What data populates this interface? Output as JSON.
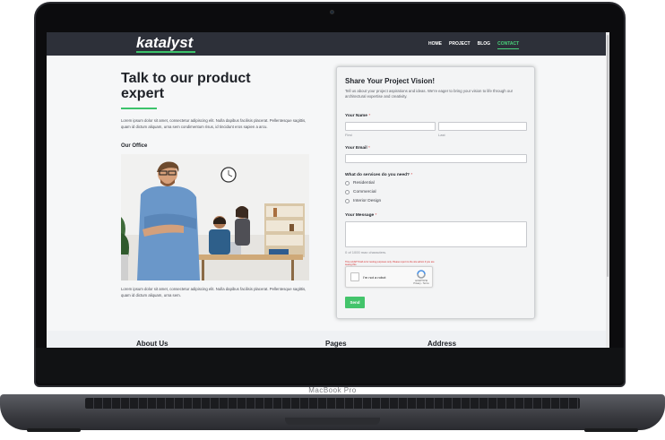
{
  "device": {
    "label": "MacBook Pro"
  },
  "nav": {
    "logo": "katalyst",
    "items": [
      {
        "label": "HOME",
        "active": false
      },
      {
        "label": "PROJECT",
        "active": false
      },
      {
        "label": "BLOG",
        "active": false
      },
      {
        "label": "CONTACT",
        "active": true
      }
    ]
  },
  "hero": {
    "title": "Talk to our product expert",
    "intro": "Lorem ipsum dolor sit amet, consectetur adipiscing elit. Nulla dapibus facilisis placerat. Pellentesque sagittis, quam id dictum aliquam, urna sem condimentum risus, id tincidunt eros sapien a arcu.",
    "office_heading": "Our Office",
    "outro": "Lorem ipsum dolor sit amet, consectetur adipiscing elit. Nulla dapibus facilisis placerat. Pellentesque sagittis, quam id dictum aliquam, urna sem."
  },
  "form": {
    "title": "Share Your Project Vision!",
    "subtitle": "Tell us about your project aspirations and ideas. We're eager to bring your vision to life through our architectural expertise and creativity.",
    "name_label": "Your Name",
    "required_mark": "*",
    "first_hint": "First",
    "last_hint": "Last",
    "email_label": "Your Email",
    "services_label": "What do services do you need?",
    "services": [
      "Residential",
      "Commercial",
      "Interior Design"
    ],
    "message_label": "Your Message",
    "char_count": "0 of 1000 max characters.",
    "captcha_warning": "This reCAPTCHA is for testing purposes only. Please report to the site admin if you are seeing this.",
    "captcha_label": "I'm not a robot",
    "captcha_brand": "reCAPTCHA",
    "captcha_links": "Privacy - Terms",
    "send_label": "Send"
  },
  "footer": {
    "headings": [
      "About Us",
      "Pages",
      "Address"
    ]
  },
  "colors": {
    "accent": "#43c46b",
    "nav_bg": "#2d3039"
  }
}
